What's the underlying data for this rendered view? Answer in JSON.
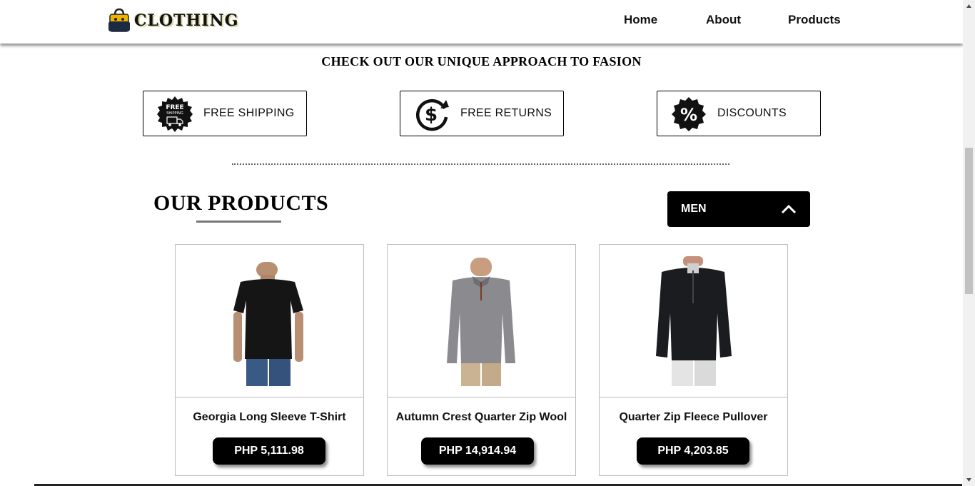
{
  "header": {
    "logo_text": "CLOTHING",
    "nav": [
      {
        "label": "Home"
      },
      {
        "label": "About"
      },
      {
        "label": "Products"
      }
    ]
  },
  "tagline": "CHECK OUT OUR UNIQUE APPROACH TO FASION",
  "features": [
    {
      "label": "FREE SHIPPING",
      "icon": "free-shipping-badge-icon",
      "badge_text_1": "FREE",
      "badge_text_2": "SHIPPING"
    },
    {
      "label": "FREE RETURNS",
      "icon": "dollar-return-icon"
    },
    {
      "label": "DISCOUNTS",
      "icon": "percent-badge-icon"
    }
  ],
  "products_section": {
    "title": "OUR PRODUCTS",
    "filter": {
      "selected": "MEN",
      "icon": "chevron-up-icon"
    }
  },
  "products": [
    {
      "name": "Georgia Long Sleeve T-Shirt",
      "price": "PHP 5,111.98",
      "image": "black-tshirt"
    },
    {
      "name": "Autumn Crest Quarter Zip Wool",
      "price": "PHP 14,914.94",
      "image": "gray-quarter-zip-sweater"
    },
    {
      "name": "Quarter Zip Fleece Pullover",
      "price": "PHP 4,203.85",
      "image": "black-fleece-pullover"
    }
  ],
  "colors": {
    "primary": "#000000",
    "background": "#ffffff",
    "card_border": "#bdbdbd"
  }
}
